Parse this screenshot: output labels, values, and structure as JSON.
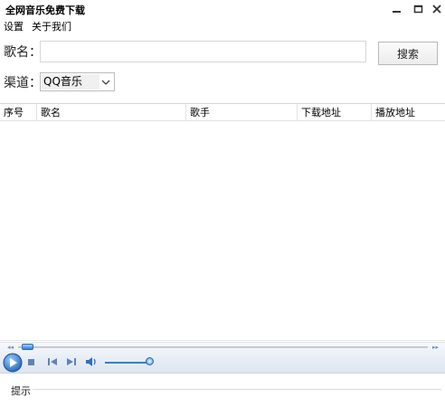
{
  "window": {
    "title": "全网音乐免费下载"
  },
  "menu": {
    "items": [
      "设置",
      "关于我们"
    ]
  },
  "form": {
    "song_label": "歌名：",
    "song_value": "",
    "search_button": "搜索",
    "channel_label": "渠道：",
    "channel_selected": "QQ音乐"
  },
  "table": {
    "columns": [
      "序号",
      "歌名",
      "歌手",
      "下载地址",
      "播放地址"
    ],
    "rows": []
  },
  "player": {
    "seek_position": 0.0,
    "volume": 1.0
  },
  "status": {
    "hint_label": "提示"
  },
  "icons": {
    "min": "minimize-icon",
    "max": "maximize-icon",
    "close": "close-icon",
    "dropdown": "chevron-down-icon",
    "play": "play-icon",
    "stop": "stop-icon",
    "prev": "previous-icon",
    "next": "next-icon",
    "volume": "speaker-icon"
  },
  "colors": {
    "accent": "#2f7fd5",
    "player_bg": "#e7edf5"
  }
}
